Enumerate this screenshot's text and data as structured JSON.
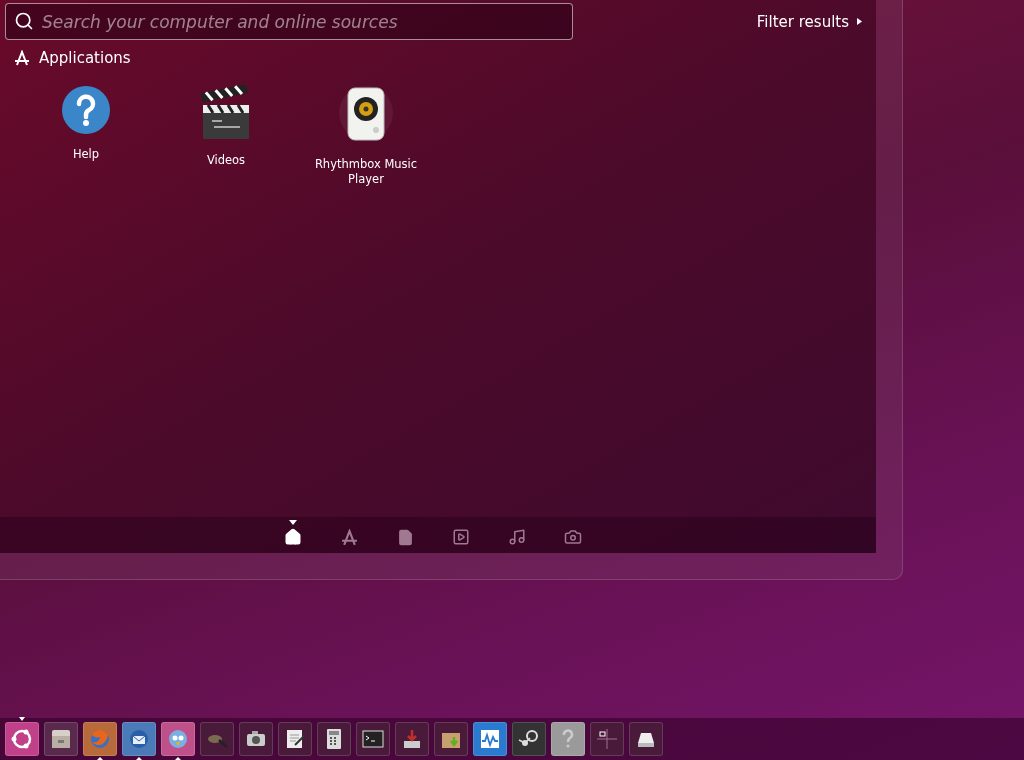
{
  "search": {
    "placeholder": "Search your computer and online sources"
  },
  "filter": {
    "label": "Filter results",
    "expanded": false
  },
  "section": {
    "title": "Applications"
  },
  "apps": [
    {
      "kind": "help",
      "name": "Help"
    },
    {
      "kind": "videos",
      "name": "Videos"
    },
    {
      "kind": "music",
      "name": "Rhythmbox Music Player"
    }
  ],
  "lenses": [
    {
      "kind": "home",
      "selected": true
    },
    {
      "kind": "apps",
      "selected": false
    },
    {
      "kind": "files",
      "selected": false
    },
    {
      "kind": "video",
      "selected": false
    },
    {
      "kind": "music",
      "selected": false
    },
    {
      "kind": "photos",
      "selected": false
    }
  ],
  "launcher": [
    {
      "kind": "dash",
      "active": true,
      "running": false
    },
    {
      "kind": "files",
      "active": false,
      "running": false
    },
    {
      "kind": "browser",
      "active": false,
      "running": true
    },
    {
      "kind": "mail",
      "active": false,
      "running": true
    },
    {
      "kind": "chat",
      "active": false,
      "running": true
    },
    {
      "kind": "paint",
      "active": false,
      "running": false
    },
    {
      "kind": "camera",
      "active": false,
      "running": false
    },
    {
      "kind": "editor",
      "active": false,
      "running": false
    },
    {
      "kind": "calculator",
      "active": false,
      "running": false
    },
    {
      "kind": "terminal",
      "active": false,
      "running": false
    },
    {
      "kind": "installer",
      "active": false,
      "running": false
    },
    {
      "kind": "archive",
      "active": false,
      "running": false
    },
    {
      "kind": "monitor",
      "active": false,
      "running": false
    },
    {
      "kind": "steam",
      "active": false,
      "running": false
    },
    {
      "kind": "help",
      "active": false,
      "running": false
    },
    {
      "kind": "workspaces",
      "active": false,
      "running": false
    },
    {
      "kind": "drive",
      "active": false,
      "running": false
    }
  ]
}
